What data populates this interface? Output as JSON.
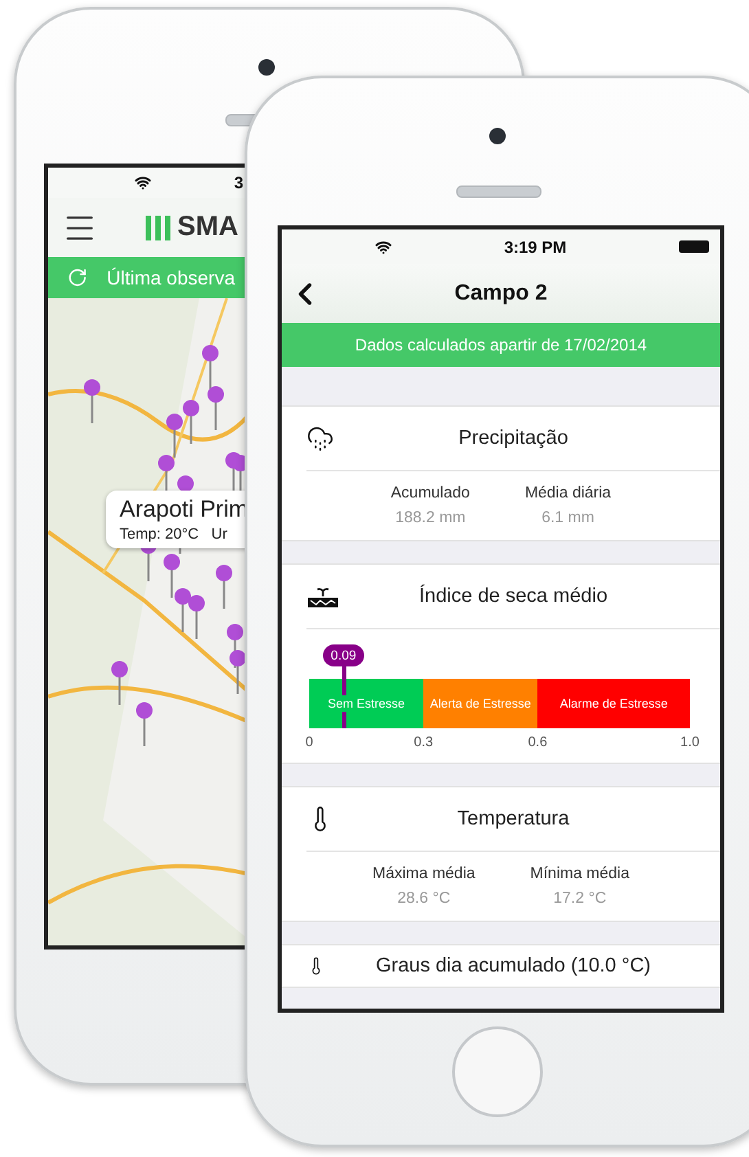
{
  "back_phone": {
    "status_bar": {
      "time": "3"
    },
    "app_bar": {
      "logo": "SMA"
    },
    "banner": {
      "text": "Última observa"
    },
    "map_callout": {
      "title": "Arapoti Prim",
      "detail": "Temp: 20°C   Ur"
    }
  },
  "front_phone": {
    "status_bar": {
      "time": "3:19 PM"
    },
    "nav": {
      "title": "Campo 2"
    },
    "banner": {
      "text": "Dados calculados apartir de 17/02/2014"
    },
    "sections": [
      {
        "kind": "stats",
        "title": "Precipitação",
        "stats": [
          {
            "label": "Acumulado",
            "value": "188.2 mm"
          },
          {
            "label": "Média diária",
            "value": "6.1 mm"
          }
        ]
      },
      {
        "kind": "gauge",
        "title": "Índice de seca médio",
        "level": 0.09,
        "reading": "0.09",
        "ticks": [
          "0",
          "0.3",
          "0.6",
          "1.0"
        ],
        "segments": [
          {
            "label": "Sem Estresse",
            "color": "#00cc55"
          },
          {
            "label": "Alerta de Estresse",
            "color": "#ff8000"
          },
          {
            "label": "Alarme de Estresse",
            "color": "#ff0000"
          }
        ]
      },
      {
        "kind": "stats",
        "title": "Temperatura",
        "stats": [
          {
            "label": "Máxima média",
            "value": "28.6 °C"
          },
          {
            "label": "Mínima média",
            "value": "17.2 °C"
          }
        ]
      },
      {
        "kind": "header",
        "title": "Graus dia acumulado (10.0 °C)"
      }
    ]
  }
}
